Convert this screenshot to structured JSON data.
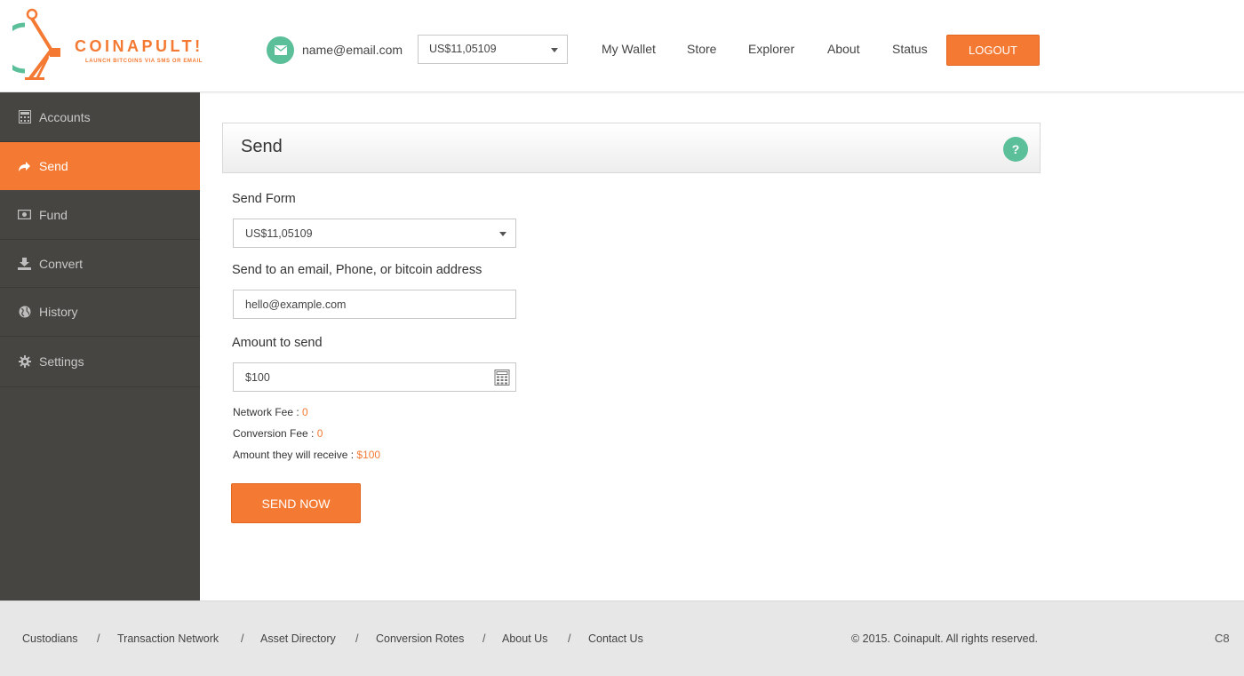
{
  "brand": {
    "name": "COINAPULT!",
    "tagline": "LAUNCH BITCOINS VIA SMS OR EMAIL",
    "accent_color": "#f47a33",
    "secondary_color": "#5bbf9a"
  },
  "header": {
    "user_email": "name@email.com",
    "email_icon": "envelope-icon",
    "balance_selected": "US$11,05109",
    "nav": [
      "My Wallet",
      "Store",
      "Explorer",
      "About",
      "Status"
    ],
    "logout_label": "LOGOUT"
  },
  "sidebar": {
    "items": [
      {
        "label": "Accounts",
        "icon": "calculator-icon",
        "active": false
      },
      {
        "label": "Send",
        "icon": "share-arrow-icon",
        "active": true
      },
      {
        "label": "Fund",
        "icon": "banknote-icon",
        "active": false
      },
      {
        "label": "Convert",
        "icon": "download-tray-icon",
        "active": false
      },
      {
        "label": "History",
        "icon": "globe-icon",
        "active": false
      },
      {
        "label": "Settings",
        "icon": "gear-icon",
        "active": false
      }
    ]
  },
  "main": {
    "panel_title": "Send",
    "help_label": "?",
    "form": {
      "from_label": "Send Form",
      "from_value": "US$11,05109",
      "to_label": "Send to an email, Phone, or bitcoin address",
      "to_placeholder": "hello@example.com",
      "amount_label": "Amount to send",
      "amount_value": "$100"
    },
    "fees": {
      "network_label": "Network Fee :",
      "network_value": "0",
      "conversion_label": "Conversion Fee :",
      "conversion_value": "0",
      "receive_label": "Amount they will receive :",
      "receive_value": "$100"
    },
    "send_button": "SEND NOW"
  },
  "footer": {
    "links": [
      "Custodians",
      "Transaction Network",
      "Asset Directory",
      "Conversion Rotes",
      "About Us",
      "Contact Us"
    ],
    "separator": "/",
    "copyright": "© 2015. Coinapult. All rights reserved.",
    "corner": "C8"
  }
}
